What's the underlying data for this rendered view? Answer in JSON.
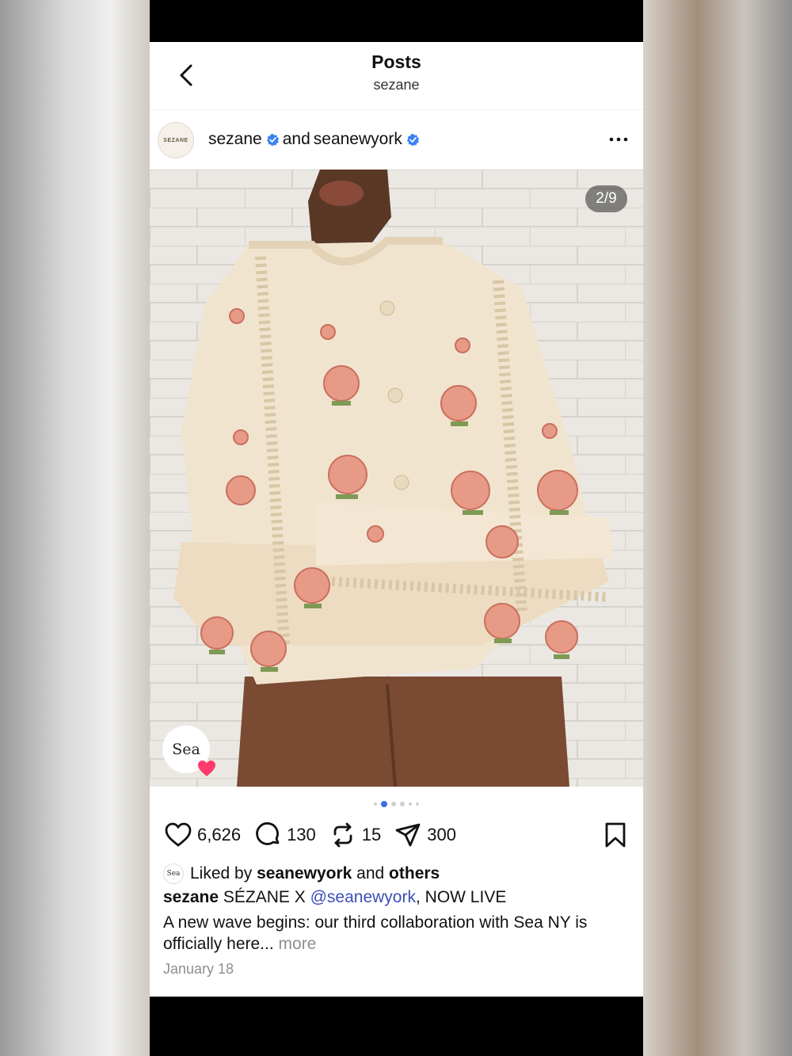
{
  "nav": {
    "title": "Posts",
    "subtitle": "sezane"
  },
  "post": {
    "author1": "sezane",
    "joiner": "and",
    "author2": "seanewyork",
    "avatar_text": "SEZANE",
    "counter": "2/9",
    "tag_badge_text": "Sea",
    "page_dots": {
      "total": 6,
      "active_index": 1
    }
  },
  "actions": {
    "likes": "6,626",
    "comments": "130",
    "reposts": "15",
    "shares": "300"
  },
  "liked_by": {
    "prefix": "Liked by",
    "user": "seanewyork",
    "and": "and",
    "others": "others",
    "avatar_text": "Sea"
  },
  "caption": {
    "user": "sezane",
    "text_before": "SÉZANE X",
    "mention": "@seanewyork",
    "text_after": ", NOW LIVE",
    "body": "A new wave begins: our third collaboration with Sea NY is officially here...",
    "more": "more",
    "date": "January 18"
  },
  "icons": {
    "back": "chevron-left-icon",
    "verified": "verified-badge-icon",
    "more": "more-dots-icon",
    "like": "heart-icon",
    "comment": "comment-icon",
    "repost": "repost-icon",
    "share": "send-icon",
    "save": "bookmark-icon"
  },
  "colors": {
    "verified": "#3b82f6",
    "mention": "#3b4fb8",
    "active_dot": "#3b6fe6",
    "tag_heart": "#ff3b6b"
  }
}
